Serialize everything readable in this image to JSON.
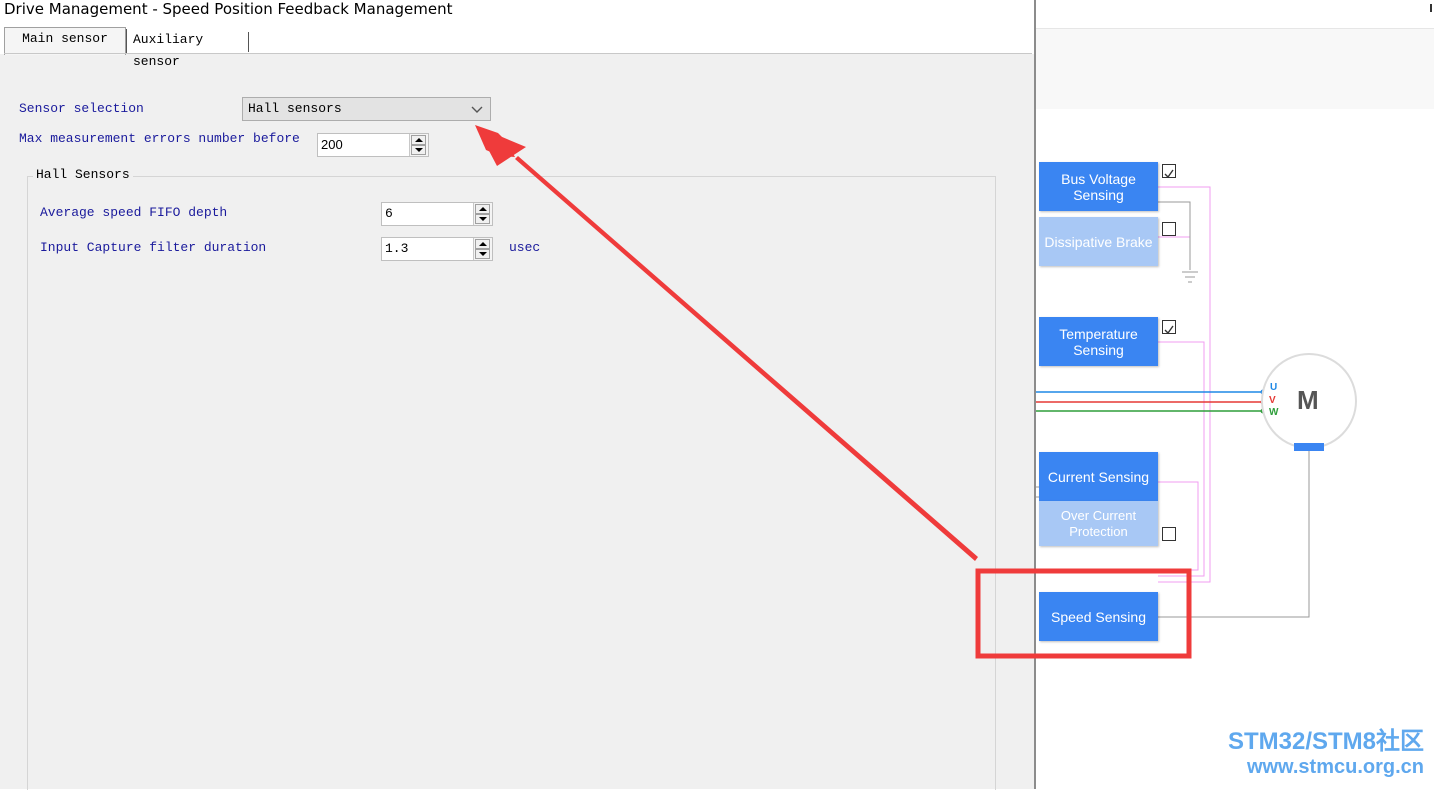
{
  "window": {
    "title": "Drive Management - Speed Position Feedback Management"
  },
  "tabs": [
    {
      "label": "Main sensor"
    },
    {
      "label": "Auxiliary sensor"
    }
  ],
  "main": {
    "sensor_selection_label": "Sensor selection",
    "sensor_selection_value": "Hall sensors",
    "max_errors_label": "Max measurement errors number before",
    "max_errors_value": "200",
    "hall_group_title": "Hall Sensors",
    "fifo_label": "Average speed FIFO depth",
    "fifo_value": "6",
    "filter_label": "Input Capture filter duration",
    "filter_value": "1.3",
    "filter_unit": "usec"
  },
  "diagram": {
    "blocks": {
      "bus_voltage": "Bus Voltage Sensing",
      "dissipative_brake": "Dissipative Brake",
      "temperature": "Temperature Sensing",
      "current": "Current Sensing",
      "over_current": "Over Current Protection",
      "speed": "Speed Sensing"
    },
    "checkboxes": {
      "bus_voltage": true,
      "dissipative_brake": false,
      "temperature": true,
      "over_current": false
    },
    "motor_label": "M",
    "phases": [
      "U",
      "V",
      "W"
    ],
    "phase_colors": [
      "#1e88e5",
      "#e53935",
      "#2e9e3a"
    ]
  },
  "annotation": {
    "arrow_color": "#ef3b3b",
    "box_color": "#ef3b3b"
  },
  "watermark": {
    "line1": "STM32/STM8社区",
    "line2": "www.stmcu.org.cn"
  }
}
